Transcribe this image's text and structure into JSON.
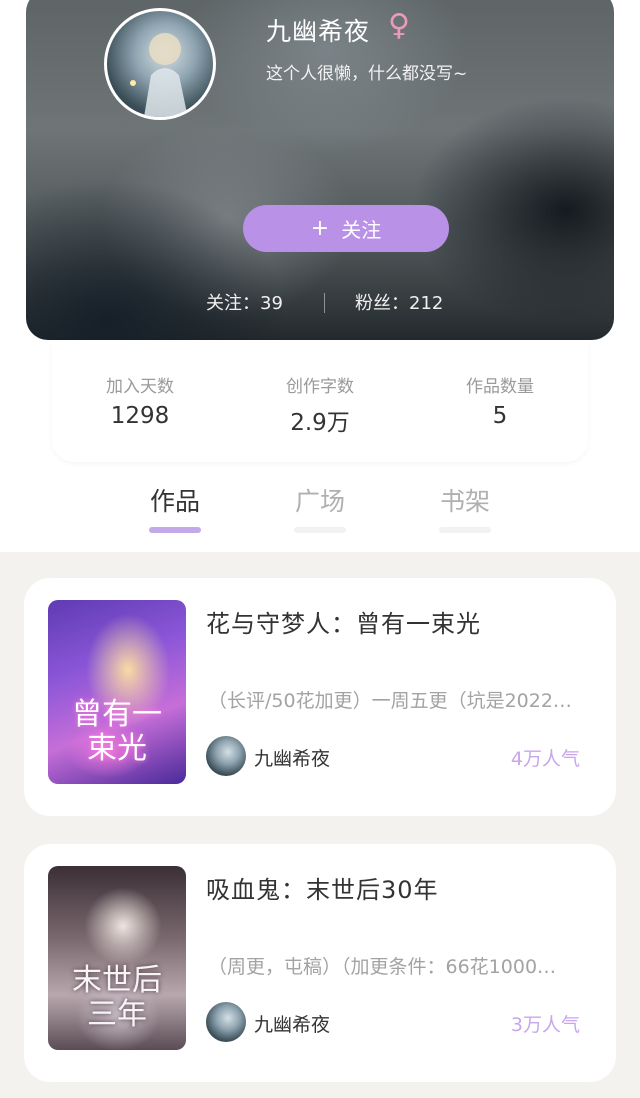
{
  "profile": {
    "nickname": "九幽希夜",
    "gender_symbol": "♀",
    "bio": "这个人很懒，什么都没写~",
    "follow_plus": "+",
    "follow_label": "关注",
    "following_text": "关注：39",
    "fans_text": "粉丝：212"
  },
  "info": [
    {
      "label": "加入天数",
      "value": "1298"
    },
    {
      "label": "创作字数",
      "value": "2.9万"
    },
    {
      "label": "作品数量",
      "value": "5"
    }
  ],
  "tabs": [
    {
      "label": "作品",
      "active": true
    },
    {
      "label": "广场",
      "active": false
    },
    {
      "label": "书架",
      "active": false
    }
  ],
  "works": [
    {
      "title": "花与守梦人：曾有一束光",
      "cover_text": "曾有一束光",
      "description": "（长评/50花加更）一周五更（坑是2022…",
      "author": "九幽希夜",
      "popularity": "4万人气"
    },
    {
      "title": "吸血鬼：末世后30年",
      "cover_text": "末世后三年",
      "description": "（周更，屯稿）（加更条件：66花1000…",
      "author": "九幽希夜",
      "popularity": "3万人气"
    }
  ],
  "colors": {
    "accent": "#b991e6",
    "accent_light": "#c3a8ea",
    "popularity": "#c7a6ec",
    "gender": "#ec9bb7"
  },
  "icons": {
    "gender": "female-icon",
    "follow": "plus-icon"
  }
}
